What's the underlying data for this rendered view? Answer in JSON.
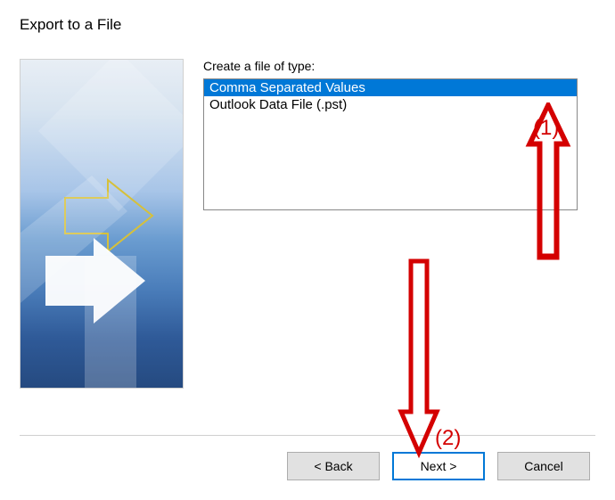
{
  "dialog": {
    "title": "Export to a File",
    "field_label": "Create a file of type:",
    "file_types": [
      {
        "label": "Comma Separated Values",
        "selected": true
      },
      {
        "label": "Outlook Data File (.pst)",
        "selected": false
      }
    ],
    "buttons": {
      "back": "< Back",
      "next": "Next >",
      "cancel": "Cancel"
    }
  },
  "annotations": {
    "label1": "(1)",
    "label2": "(2)"
  }
}
